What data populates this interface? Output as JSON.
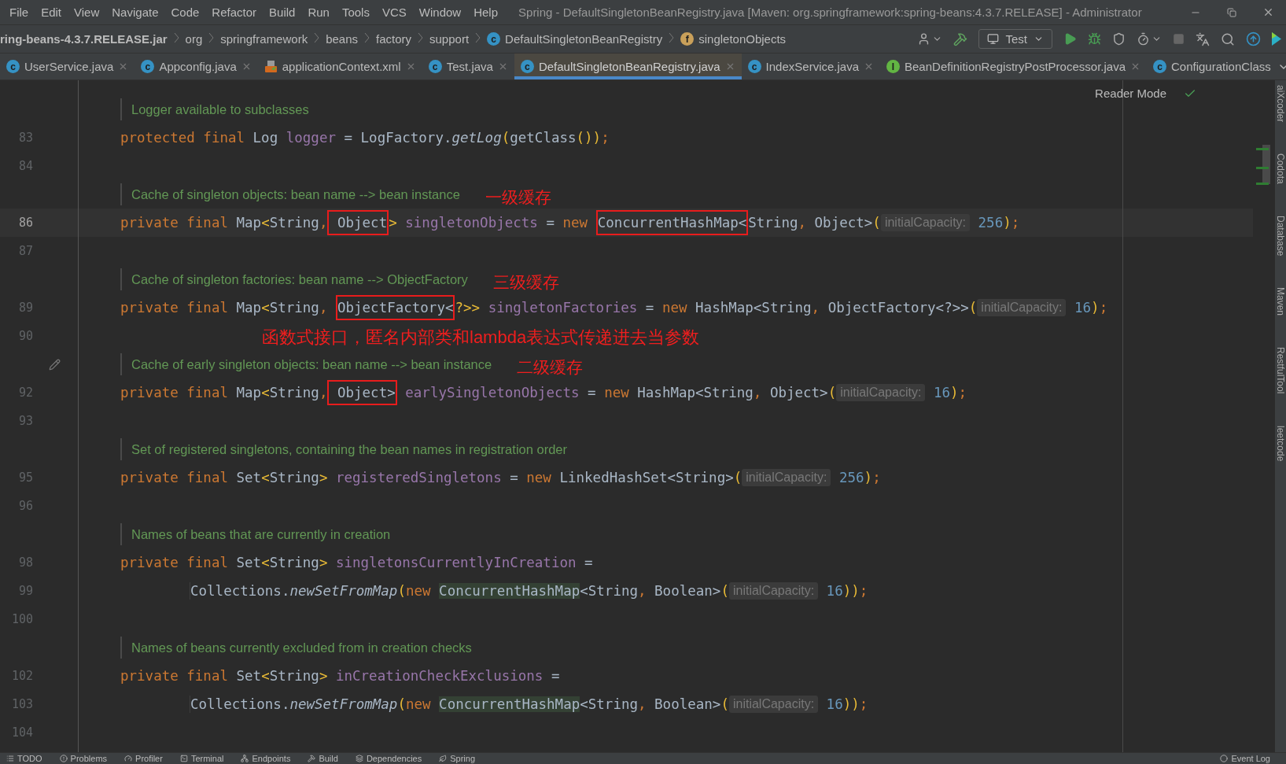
{
  "menu": [
    "File",
    "Edit",
    "View",
    "Navigate",
    "Code",
    "Refactor",
    "Build",
    "Run",
    "Tools",
    "VCS",
    "Window",
    "Help"
  ],
  "window": {
    "title": "Spring - DefaultSingletonBeanRegistry.java [Maven: org.springframework:spring-beans:4.3.7.RELEASE] - Administrator"
  },
  "breadcrumbs": [
    {
      "label": "ring-beans-4.3.7.RELEASE.jar",
      "kind": "jar"
    },
    {
      "label": "org",
      "kind": "package"
    },
    {
      "label": "springframework",
      "kind": "package"
    },
    {
      "label": "beans",
      "kind": "package"
    },
    {
      "label": "factory",
      "kind": "package"
    },
    {
      "label": "support",
      "kind": "package"
    },
    {
      "label": "DefaultSingletonBeanRegistry",
      "kind": "class",
      "badge": "c"
    },
    {
      "label": "singletonObjects",
      "kind": "field",
      "badge": "f"
    }
  ],
  "run_config": {
    "label": "Test"
  },
  "tabs": [
    {
      "label": "UserService.java",
      "kind": "class",
      "badge": "c",
      "selected": false
    },
    {
      "label": "Appconfig.java",
      "kind": "class",
      "badge": "c",
      "selected": false
    },
    {
      "label": "applicationContext.xml",
      "kind": "xml",
      "selected": false
    },
    {
      "label": "Test.java",
      "kind": "test",
      "badge": "c",
      "selected": false
    },
    {
      "label": "DefaultSingletonBeanRegistry.java",
      "kind": "class",
      "badge": "c",
      "selected": true
    },
    {
      "label": "IndexService.java",
      "kind": "class",
      "badge": "c",
      "selected": false
    },
    {
      "label": "BeanDefinitionRegistryPostProcessor.java",
      "kind": "interface",
      "badge": "I",
      "selected": false
    },
    {
      "label": "ConfigurationClass",
      "kind": "class",
      "badge": "c",
      "selected": false
    }
  ],
  "reader_mode": "Reader Mode",
  "lines": [
    {
      "kind": "doc",
      "text": "Logger available to subclasses"
    },
    {
      "kind": "code",
      "number": "83",
      "current": false,
      "tokens": [
        {
          "text": "protected final ",
          "kind": "kw"
        },
        {
          "text": "Log ",
          "kind": "plain"
        },
        {
          "text": "logger",
          "kind": "field"
        },
        {
          "text": " = LogFactory.",
          "kind": "plain"
        },
        {
          "text": "getLog",
          "kind": "italic"
        },
        {
          "text": "(",
          "kind": "br"
        },
        {
          "text": "getClass",
          "kind": "plain"
        },
        {
          "text": "()",
          "kind": "br"
        },
        {
          "text": ")",
          "kind": "br"
        },
        {
          "text": ";",
          "kind": "kw"
        }
      ]
    },
    {
      "kind": "code",
      "number": "84",
      "current": false
    },
    {
      "kind": "doc",
      "text": "Cache of singleton objects: bean name --> bean instance",
      "note": "一级缓存"
    },
    {
      "kind": "code",
      "number": "86",
      "current": true,
      "tokens": [
        {
          "text": "private final ",
          "kind": "kw"
        },
        {
          "text": "Map",
          "kind": "plain"
        },
        {
          "text": "<",
          "kind": "br"
        },
        {
          "text": "String",
          "kind": "plain"
        },
        {
          "text": ",",
          "kind": "kw"
        },
        {
          "text": " Object",
          "kind": "plain",
          "boxed": true
        },
        {
          "text": "> ",
          "kind": "br"
        },
        {
          "text": "singletonObjects",
          "kind": "field"
        },
        {
          "text": " = ",
          "kind": "plain"
        },
        {
          "text": "new ",
          "kind": "kw"
        },
        {
          "text": "ConcurrentHashMap<",
          "kind": "plain",
          "boxed": true
        },
        {
          "text": "String",
          "kind": "plain"
        },
        {
          "text": ", ",
          "kind": "kw"
        },
        {
          "text": "Object",
          "kind": "plain"
        },
        {
          "text": ">",
          "kind": "plain"
        },
        {
          "text": "(",
          "kind": "br"
        },
        {
          "text": "initialCapacity:",
          "kind": "hint"
        },
        {
          "text": " 256",
          "kind": "num"
        },
        {
          "text": ")",
          "kind": "br"
        },
        {
          "text": ";",
          "kind": "kw"
        }
      ]
    },
    {
      "kind": "code",
      "number": "87",
      "current": false
    },
    {
      "kind": "doc",
      "text": "Cache of singleton factories: bean name --> ObjectFactory",
      "note": "三级缓存"
    },
    {
      "kind": "code",
      "number": "89",
      "current": false,
      "tokens": [
        {
          "text": "private final ",
          "kind": "kw"
        },
        {
          "text": "Map",
          "kind": "plain"
        },
        {
          "text": "<",
          "kind": "br"
        },
        {
          "text": "String",
          "kind": "plain"
        },
        {
          "text": ", ",
          "kind": "kw"
        },
        {
          "text": "ObjectFactory<",
          "kind": "plain",
          "boxed": true
        },
        {
          "text": "?>> ",
          "kind": "br"
        },
        {
          "text": "singletonFactories",
          "kind": "field"
        },
        {
          "text": " = ",
          "kind": "plain"
        },
        {
          "text": "new ",
          "kind": "kw"
        },
        {
          "text": "HashMap<String",
          "kind": "plain"
        },
        {
          "text": ", ",
          "kind": "kw"
        },
        {
          "text": "ObjectFactory<?>>",
          "kind": "plain"
        },
        {
          "text": "(",
          "kind": "br"
        },
        {
          "text": "initialCapacity:",
          "kind": "hint"
        },
        {
          "text": " 16",
          "kind": "num"
        },
        {
          "text": ")",
          "kind": "br"
        },
        {
          "text": ";",
          "kind": "kw"
        }
      ]
    },
    {
      "kind": "code",
      "number": "90",
      "current": false,
      "note": "函数式接口，匿名内部类和lambda表达式传递进去当参数"
    },
    {
      "kind": "doc",
      "text": "Cache of early singleton objects: bean name --> bean instance",
      "note": "二级缓存",
      "edited": true
    },
    {
      "kind": "code",
      "number": "92",
      "current": false,
      "tokens": [
        {
          "text": "private final ",
          "kind": "kw"
        },
        {
          "text": "Map",
          "kind": "plain"
        },
        {
          "text": "<",
          "kind": "br"
        },
        {
          "text": "String",
          "kind": "plain"
        },
        {
          "text": ",",
          "kind": "kw"
        },
        {
          "text": " Object>",
          "kind": "plain",
          "boxed": true
        },
        {
          "text": " earlySingletonObjects",
          "kind": "field"
        },
        {
          "text": " = ",
          "kind": "plain"
        },
        {
          "text": "new ",
          "kind": "kw"
        },
        {
          "text": "HashMap<String",
          "kind": "plain"
        },
        {
          "text": ", ",
          "kind": "kw"
        },
        {
          "text": "Object>",
          "kind": "plain"
        },
        {
          "text": "(",
          "kind": "br"
        },
        {
          "text": "initialCapacity:",
          "kind": "hint"
        },
        {
          "text": " 16",
          "kind": "num"
        },
        {
          "text": ")",
          "kind": "br"
        },
        {
          "text": ";",
          "kind": "kw"
        }
      ]
    },
    {
      "kind": "code",
      "number": "93",
      "current": false
    },
    {
      "kind": "doc",
      "text": "Set of registered singletons, containing the bean names in registration order"
    },
    {
      "kind": "code",
      "number": "95",
      "current": false,
      "tokens": [
        {
          "text": "private final ",
          "kind": "kw"
        },
        {
          "text": "Set",
          "kind": "plain"
        },
        {
          "text": "<",
          "kind": "br"
        },
        {
          "text": "String",
          "kind": "plain"
        },
        {
          "text": "> ",
          "kind": "br"
        },
        {
          "text": "registeredSingletons",
          "kind": "field"
        },
        {
          "text": " = ",
          "kind": "plain"
        },
        {
          "text": "new ",
          "kind": "kw"
        },
        {
          "text": "LinkedHashSet<String>",
          "kind": "plain"
        },
        {
          "text": "(",
          "kind": "br"
        },
        {
          "text": "initialCapacity:",
          "kind": "hint"
        },
        {
          "text": " 256",
          "kind": "num"
        },
        {
          "text": ")",
          "kind": "br"
        },
        {
          "text": ";",
          "kind": "kw"
        }
      ]
    },
    {
      "kind": "code",
      "number": "96",
      "current": false
    },
    {
      "kind": "doc",
      "text": "Names of beans that are currently in creation"
    },
    {
      "kind": "code",
      "number": "98",
      "current": false,
      "tokens": [
        {
          "text": "private final ",
          "kind": "kw"
        },
        {
          "text": "Set",
          "kind": "plain"
        },
        {
          "text": "<",
          "kind": "br"
        },
        {
          "text": "String",
          "kind": "plain"
        },
        {
          "text": "> ",
          "kind": "br"
        },
        {
          "text": "singletonsCurrentlyInCreation",
          "kind": "field"
        },
        {
          "text": " =",
          "kind": "plain"
        }
      ]
    },
    {
      "kind": "continuation",
      "number": "99",
      "current": false,
      "tokens": [
        {
          "text": "Collections.",
          "kind": "plain"
        },
        {
          "text": "newSetFromMap",
          "kind": "italic"
        },
        {
          "text": "(",
          "kind": "br"
        },
        {
          "text": "new ",
          "kind": "kw"
        },
        {
          "text": "ConcurrentHashMap",
          "kind": "usage"
        },
        {
          "text": "<String",
          "kind": "plain"
        },
        {
          "text": ", ",
          "kind": "kw"
        },
        {
          "text": "Boolean>",
          "kind": "plain"
        },
        {
          "text": "(",
          "kind": "br"
        },
        {
          "text": "initialCapacity:",
          "kind": "hint"
        },
        {
          "text": " 16",
          "kind": "num"
        },
        {
          "text": "))",
          "kind": "br"
        },
        {
          "text": ";",
          "kind": "kw"
        }
      ]
    },
    {
      "kind": "code",
      "number": "100",
      "current": false
    },
    {
      "kind": "doc",
      "text": "Names of beans currently excluded from in creation checks"
    },
    {
      "kind": "code",
      "number": "102",
      "current": false,
      "tokens": [
        {
          "text": "private final ",
          "kind": "kw"
        },
        {
          "text": "Set",
          "kind": "plain"
        },
        {
          "text": "<",
          "kind": "br"
        },
        {
          "text": "String",
          "kind": "plain"
        },
        {
          "text": "> ",
          "kind": "br"
        },
        {
          "text": "inCreationCheckExclusions",
          "kind": "field"
        },
        {
          "text": " =",
          "kind": "plain"
        }
      ]
    },
    {
      "kind": "continuation",
      "number": "103",
      "current": false,
      "tokens": [
        {
          "text": "Collections.",
          "kind": "plain"
        },
        {
          "text": "newSetFromMap",
          "kind": "italic"
        },
        {
          "text": "(",
          "kind": "br"
        },
        {
          "text": "new ",
          "kind": "kw"
        },
        {
          "text": "ConcurrentHashMap",
          "kind": "usage"
        },
        {
          "text": "<String",
          "kind": "plain"
        },
        {
          "text": ", ",
          "kind": "kw"
        },
        {
          "text": "Boolean>",
          "kind": "plain"
        },
        {
          "text": "(",
          "kind": "br"
        },
        {
          "text": "initialCapacity:",
          "kind": "hint"
        },
        {
          "text": " 16",
          "kind": "num"
        },
        {
          "text": "))",
          "kind": "br"
        },
        {
          "text": ";",
          "kind": "kw"
        }
      ]
    },
    {
      "kind": "code",
      "number": "104",
      "current": false
    }
  ],
  "side_tools": [
    "aiXcoder",
    "Codota",
    "Database",
    "Maven",
    "RestfulTool",
    "leetcode"
  ],
  "tool_windows": [
    "TODO",
    "Problems",
    "Profiler",
    "Terminal",
    "Endpoints",
    "Build",
    "Dependencies",
    "Spring"
  ],
  "event_log": "Event Log"
}
